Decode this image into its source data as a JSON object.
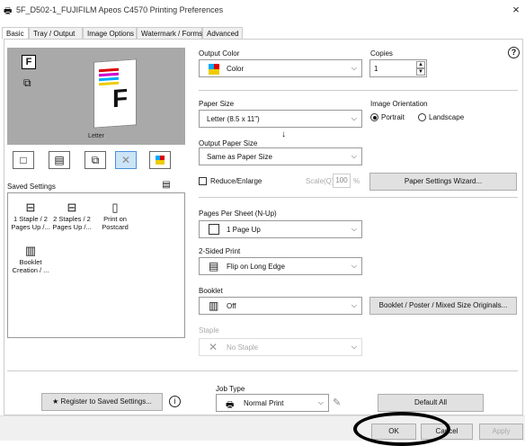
{
  "window": {
    "title": "5F_D502-1_FUJIFILM Apeos C4570 Printing Preferences",
    "close_glyph": "×"
  },
  "tabs": [
    {
      "label": "Basic",
      "active": true
    },
    {
      "label": "Tray / Output",
      "active": false
    },
    {
      "label": "Image Options",
      "active": false
    },
    {
      "label": "Watermark / Forms",
      "active": false
    },
    {
      "label": "Advanced",
      "active": false
    }
  ],
  "help_glyph": "?",
  "preview": {
    "paper_label": "Letter"
  },
  "saved_settings": {
    "label": "Saved Settings",
    "items": [
      {
        "label": "1 Staple / 2 Pages Up /..."
      },
      {
        "label": "2 Staples / 2 Pages Up /..."
      },
      {
        "label": "Print on Postcard"
      },
      {
        "label": "Booklet Creation / ..."
      }
    ],
    "register_button": "Register to Saved Settings..."
  },
  "output_color": {
    "label": "Output Color",
    "value": "Color"
  },
  "copies": {
    "label": "Copies",
    "value": "1"
  },
  "paper_size": {
    "label": "Paper Size",
    "value": "Letter (8.5 x 11\")"
  },
  "arrow_down_glyph": "↓",
  "output_paper_size": {
    "label": "Output Paper Size",
    "value": "Same as Paper Size"
  },
  "orientation": {
    "label": "Image Orientation",
    "portrait": "Portrait",
    "landscape": "Landscape",
    "selected": "Portrait"
  },
  "reduce_enlarge": {
    "label": "Reduce/Enlarge",
    "scale_label": "Scale(Q)",
    "scale_value": "100",
    "unit": "%"
  },
  "paper_wizard_button": "Paper Settings Wizard...",
  "pages_per_sheet": {
    "label": "Pages Per Sheet (N-Up)",
    "value": "1 Page Up"
  },
  "two_sided": {
    "label": "2-Sided Print",
    "value": "Flip on Long Edge"
  },
  "booklet": {
    "label": "Booklet",
    "value": "Off",
    "button": "Booklet / Poster / Mixed Size Originals..."
  },
  "staple": {
    "label": "Staple",
    "value": "No Staple"
  },
  "job_type": {
    "label": "Job Type",
    "value": "Normal Print"
  },
  "default_all_button": "Default All",
  "footer": {
    "ok": "OK",
    "cancel": "Cancel",
    "apply": "Apply"
  }
}
